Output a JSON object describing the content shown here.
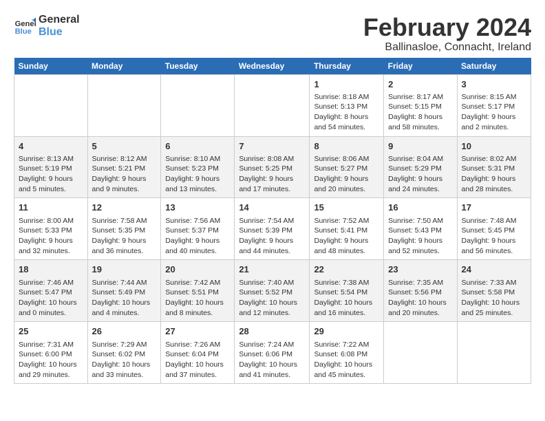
{
  "header": {
    "logo_line1": "General",
    "logo_line2": "Blue",
    "title": "February 2024",
    "subtitle": "Ballinasloe, Connacht, Ireland"
  },
  "days_of_week": [
    "Sunday",
    "Monday",
    "Tuesday",
    "Wednesday",
    "Thursday",
    "Friday",
    "Saturday"
  ],
  "weeks": [
    [
      {
        "day": "",
        "content": ""
      },
      {
        "day": "",
        "content": ""
      },
      {
        "day": "",
        "content": ""
      },
      {
        "day": "",
        "content": ""
      },
      {
        "day": "1",
        "content": "Sunrise: 8:18 AM\nSunset: 5:13 PM\nDaylight: 8 hours\nand 54 minutes."
      },
      {
        "day": "2",
        "content": "Sunrise: 8:17 AM\nSunset: 5:15 PM\nDaylight: 8 hours\nand 58 minutes."
      },
      {
        "day": "3",
        "content": "Sunrise: 8:15 AM\nSunset: 5:17 PM\nDaylight: 9 hours\nand 2 minutes."
      }
    ],
    [
      {
        "day": "4",
        "content": "Sunrise: 8:13 AM\nSunset: 5:19 PM\nDaylight: 9 hours\nand 5 minutes."
      },
      {
        "day": "5",
        "content": "Sunrise: 8:12 AM\nSunset: 5:21 PM\nDaylight: 9 hours\nand 9 minutes."
      },
      {
        "day": "6",
        "content": "Sunrise: 8:10 AM\nSunset: 5:23 PM\nDaylight: 9 hours\nand 13 minutes."
      },
      {
        "day": "7",
        "content": "Sunrise: 8:08 AM\nSunset: 5:25 PM\nDaylight: 9 hours\nand 17 minutes."
      },
      {
        "day": "8",
        "content": "Sunrise: 8:06 AM\nSunset: 5:27 PM\nDaylight: 9 hours\nand 20 minutes."
      },
      {
        "day": "9",
        "content": "Sunrise: 8:04 AM\nSunset: 5:29 PM\nDaylight: 9 hours\nand 24 minutes."
      },
      {
        "day": "10",
        "content": "Sunrise: 8:02 AM\nSunset: 5:31 PM\nDaylight: 9 hours\nand 28 minutes."
      }
    ],
    [
      {
        "day": "11",
        "content": "Sunrise: 8:00 AM\nSunset: 5:33 PM\nDaylight: 9 hours\nand 32 minutes."
      },
      {
        "day": "12",
        "content": "Sunrise: 7:58 AM\nSunset: 5:35 PM\nDaylight: 9 hours\nand 36 minutes."
      },
      {
        "day": "13",
        "content": "Sunrise: 7:56 AM\nSunset: 5:37 PM\nDaylight: 9 hours\nand 40 minutes."
      },
      {
        "day": "14",
        "content": "Sunrise: 7:54 AM\nSunset: 5:39 PM\nDaylight: 9 hours\nand 44 minutes."
      },
      {
        "day": "15",
        "content": "Sunrise: 7:52 AM\nSunset: 5:41 PM\nDaylight: 9 hours\nand 48 minutes."
      },
      {
        "day": "16",
        "content": "Sunrise: 7:50 AM\nSunset: 5:43 PM\nDaylight: 9 hours\nand 52 minutes."
      },
      {
        "day": "17",
        "content": "Sunrise: 7:48 AM\nSunset: 5:45 PM\nDaylight: 9 hours\nand 56 minutes."
      }
    ],
    [
      {
        "day": "18",
        "content": "Sunrise: 7:46 AM\nSunset: 5:47 PM\nDaylight: 10 hours\nand 0 minutes."
      },
      {
        "day": "19",
        "content": "Sunrise: 7:44 AM\nSunset: 5:49 PM\nDaylight: 10 hours\nand 4 minutes."
      },
      {
        "day": "20",
        "content": "Sunrise: 7:42 AM\nSunset: 5:51 PM\nDaylight: 10 hours\nand 8 minutes."
      },
      {
        "day": "21",
        "content": "Sunrise: 7:40 AM\nSunset: 5:52 PM\nDaylight: 10 hours\nand 12 minutes."
      },
      {
        "day": "22",
        "content": "Sunrise: 7:38 AM\nSunset: 5:54 PM\nDaylight: 10 hours\nand 16 minutes."
      },
      {
        "day": "23",
        "content": "Sunrise: 7:35 AM\nSunset: 5:56 PM\nDaylight: 10 hours\nand 20 minutes."
      },
      {
        "day": "24",
        "content": "Sunrise: 7:33 AM\nSunset: 5:58 PM\nDaylight: 10 hours\nand 25 minutes."
      }
    ],
    [
      {
        "day": "25",
        "content": "Sunrise: 7:31 AM\nSunset: 6:00 PM\nDaylight: 10 hours\nand 29 minutes."
      },
      {
        "day": "26",
        "content": "Sunrise: 7:29 AM\nSunset: 6:02 PM\nDaylight: 10 hours\nand 33 minutes."
      },
      {
        "day": "27",
        "content": "Sunrise: 7:26 AM\nSunset: 6:04 PM\nDaylight: 10 hours\nand 37 minutes."
      },
      {
        "day": "28",
        "content": "Sunrise: 7:24 AM\nSunset: 6:06 PM\nDaylight: 10 hours\nand 41 minutes."
      },
      {
        "day": "29",
        "content": "Sunrise: 7:22 AM\nSunset: 6:08 PM\nDaylight: 10 hours\nand 45 minutes."
      },
      {
        "day": "",
        "content": ""
      },
      {
        "day": "",
        "content": ""
      }
    ]
  ]
}
